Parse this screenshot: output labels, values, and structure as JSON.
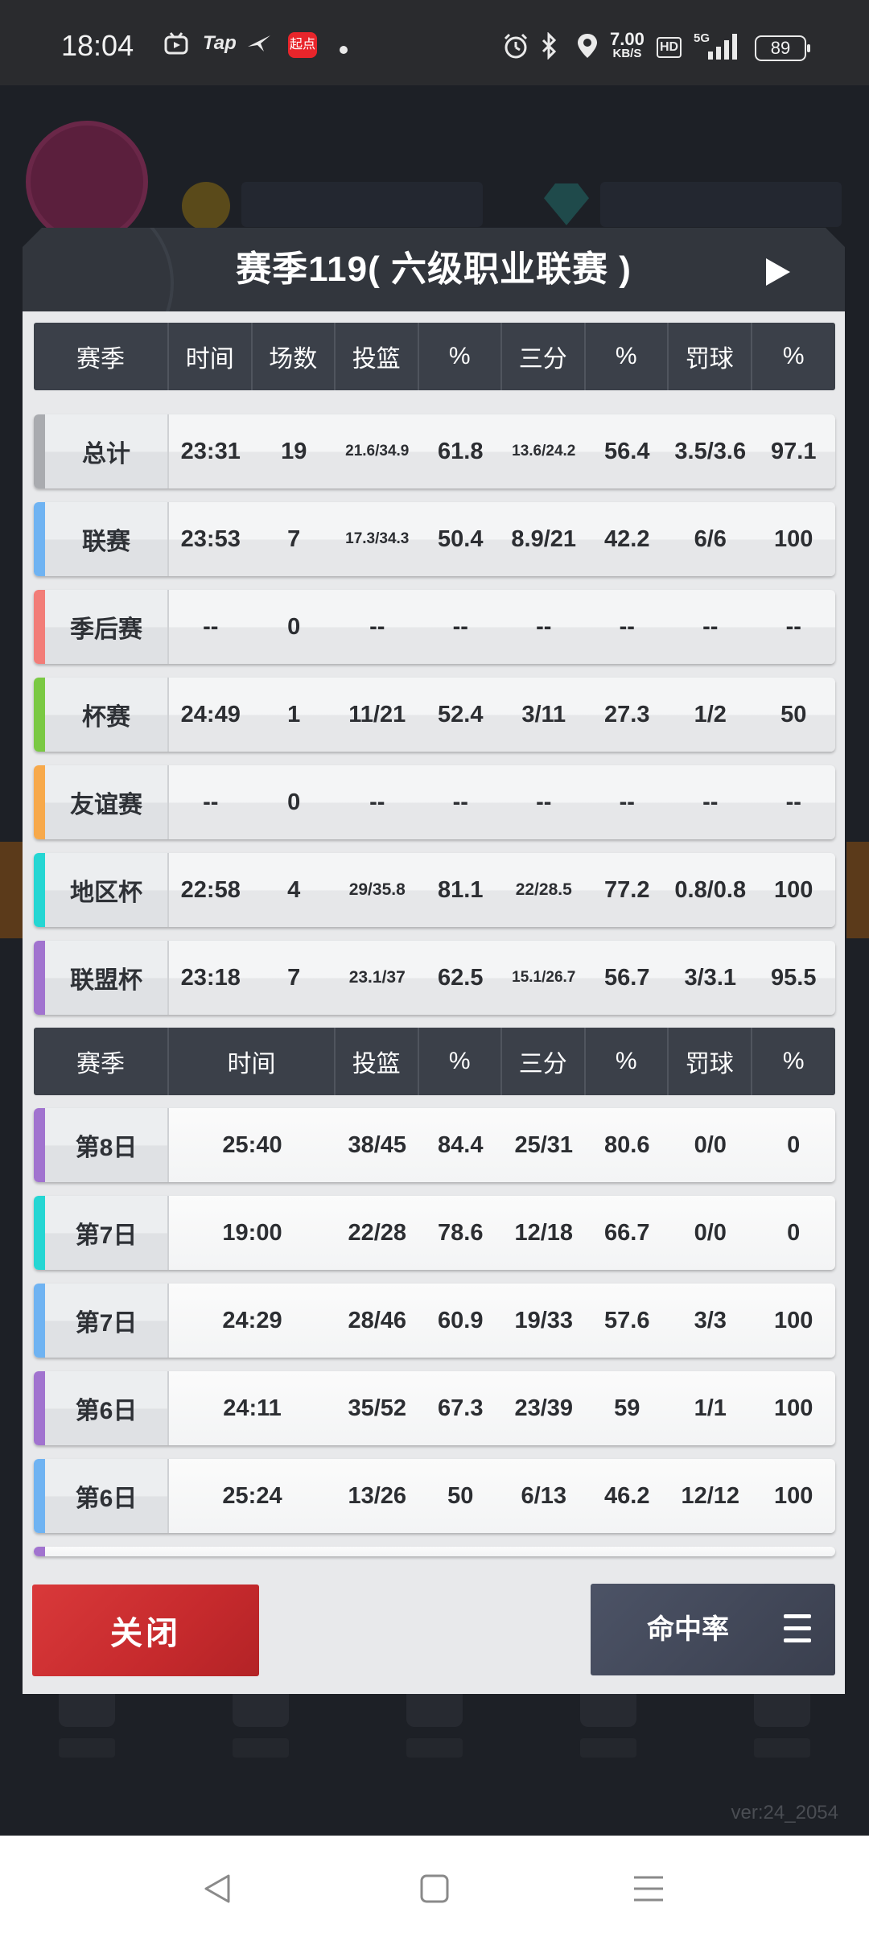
{
  "status_bar": {
    "time": "18:04",
    "apps": [
      "Tap"
    ],
    "badge": "起点",
    "speed_value": "7.00",
    "speed_unit": "KB/S",
    "hd": "HD",
    "network": "5G",
    "battery": "89"
  },
  "modal": {
    "title": "赛季119( 六级职业联赛 )",
    "summary_headers": [
      "赛季",
      "时间",
      "场数",
      "投篮",
      "%",
      "三分",
      "%",
      "罚球",
      "%"
    ],
    "summary_rows": [
      {
        "label": "总计",
        "accent": "#a9abaf",
        "time": "23:31",
        "games": "19",
        "fg": "21.6/34.9",
        "fg_pct": "61.8",
        "three": "13.6/24.2",
        "three_pct": "56.4",
        "ft": "3.5/3.6",
        "ft_pct": "97.1"
      },
      {
        "label": "联赛",
        "accent": "#6fb3f2",
        "time": "23:53",
        "games": "7",
        "fg": "17.3/34.3",
        "fg_pct": "50.4",
        "three": "8.9/21",
        "three_pct": "42.2",
        "ft": "6/6",
        "ft_pct": "100"
      },
      {
        "label": "季后赛",
        "accent": "#f27d78",
        "time": "--",
        "games": "0",
        "fg": "--",
        "fg_pct": "--",
        "three": "--",
        "three_pct": "--",
        "ft": "--",
        "ft_pct": "--"
      },
      {
        "label": "杯赛",
        "accent": "#7ac943",
        "time": "24:49",
        "games": "1",
        "fg": "11/21",
        "fg_pct": "52.4",
        "three": "3/11",
        "three_pct": "27.3",
        "ft": "1/2",
        "ft_pct": "50"
      },
      {
        "label": "友谊赛",
        "accent": "#f7a94b",
        "time": "--",
        "games": "0",
        "fg": "--",
        "fg_pct": "--",
        "three": "--",
        "three_pct": "--",
        "ft": "--",
        "ft_pct": "--"
      },
      {
        "label": "地区杯",
        "accent": "#25d6d3",
        "time": "22:58",
        "games": "4",
        "fg": "29/35.8",
        "fg_pct": "81.1",
        "three": "22/28.5",
        "three_pct": "77.2",
        "ft": "0.8/0.8",
        "ft_pct": "100"
      },
      {
        "label": "联盟杯",
        "accent": "#a173cf",
        "time": "23:18",
        "games": "7",
        "fg": "23.1/37",
        "fg_pct": "62.5",
        "three": "15.1/26.7",
        "three_pct": "56.7",
        "ft": "3/3.1",
        "ft_pct": "95.5"
      }
    ],
    "game_headers": [
      "赛季",
      "时间",
      "投篮",
      "%",
      "三分",
      "%",
      "罚球",
      "%"
    ],
    "game_rows": [
      {
        "label": "第8日",
        "accent": "#a173cf",
        "time": "25:40",
        "fg": "38/45",
        "fg_pct": "84.4",
        "three": "25/31",
        "three_pct": "80.6",
        "ft": "0/0",
        "ft_pct": "0"
      },
      {
        "label": "第7日",
        "accent": "#25d6d3",
        "time": "19:00",
        "fg": "22/28",
        "fg_pct": "78.6",
        "three": "12/18",
        "three_pct": "66.7",
        "ft": "0/0",
        "ft_pct": "0"
      },
      {
        "label": "第7日",
        "accent": "#6fb3f2",
        "time": "24:29",
        "fg": "28/46",
        "fg_pct": "60.9",
        "three": "19/33",
        "three_pct": "57.6",
        "ft": "3/3",
        "ft_pct": "100"
      },
      {
        "label": "第6日",
        "accent": "#a173cf",
        "time": "24:11",
        "fg": "35/52",
        "fg_pct": "67.3",
        "three": "23/39",
        "three_pct": "59",
        "ft": "1/1",
        "ft_pct": "100"
      },
      {
        "label": "第6日",
        "accent": "#6fb3f2",
        "time": "25:24",
        "fg": "13/26",
        "fg_pct": "50",
        "three": "6/13",
        "three_pct": "46.2",
        "ft": "12/12",
        "ft_pct": "100"
      }
    ],
    "close_label": "关闭",
    "rate_label": "命中率"
  },
  "version": "ver:24_2054",
  "icons": [
    "play-icon",
    "menu-icon",
    "back-icon",
    "home-icon",
    "recents-icon",
    "alarm-icon",
    "bluetooth-icon",
    "location-icon",
    "signal-icon",
    "battery-icon"
  ]
}
